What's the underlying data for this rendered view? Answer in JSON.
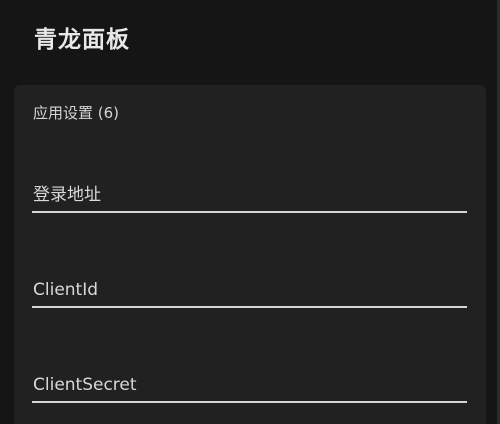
{
  "app": {
    "title": "青龙面板"
  },
  "settings": {
    "section_title": "应用设置 (6)",
    "fields": [
      {
        "label": "登录地址",
        "value": ""
      },
      {
        "label": "ClientId",
        "value": ""
      },
      {
        "label": "ClientSecret",
        "value": ""
      }
    ]
  },
  "colors": {
    "background": "#151515",
    "card": "#212121",
    "text": "#e8e8e8",
    "underline": "#d6d6d6"
  }
}
